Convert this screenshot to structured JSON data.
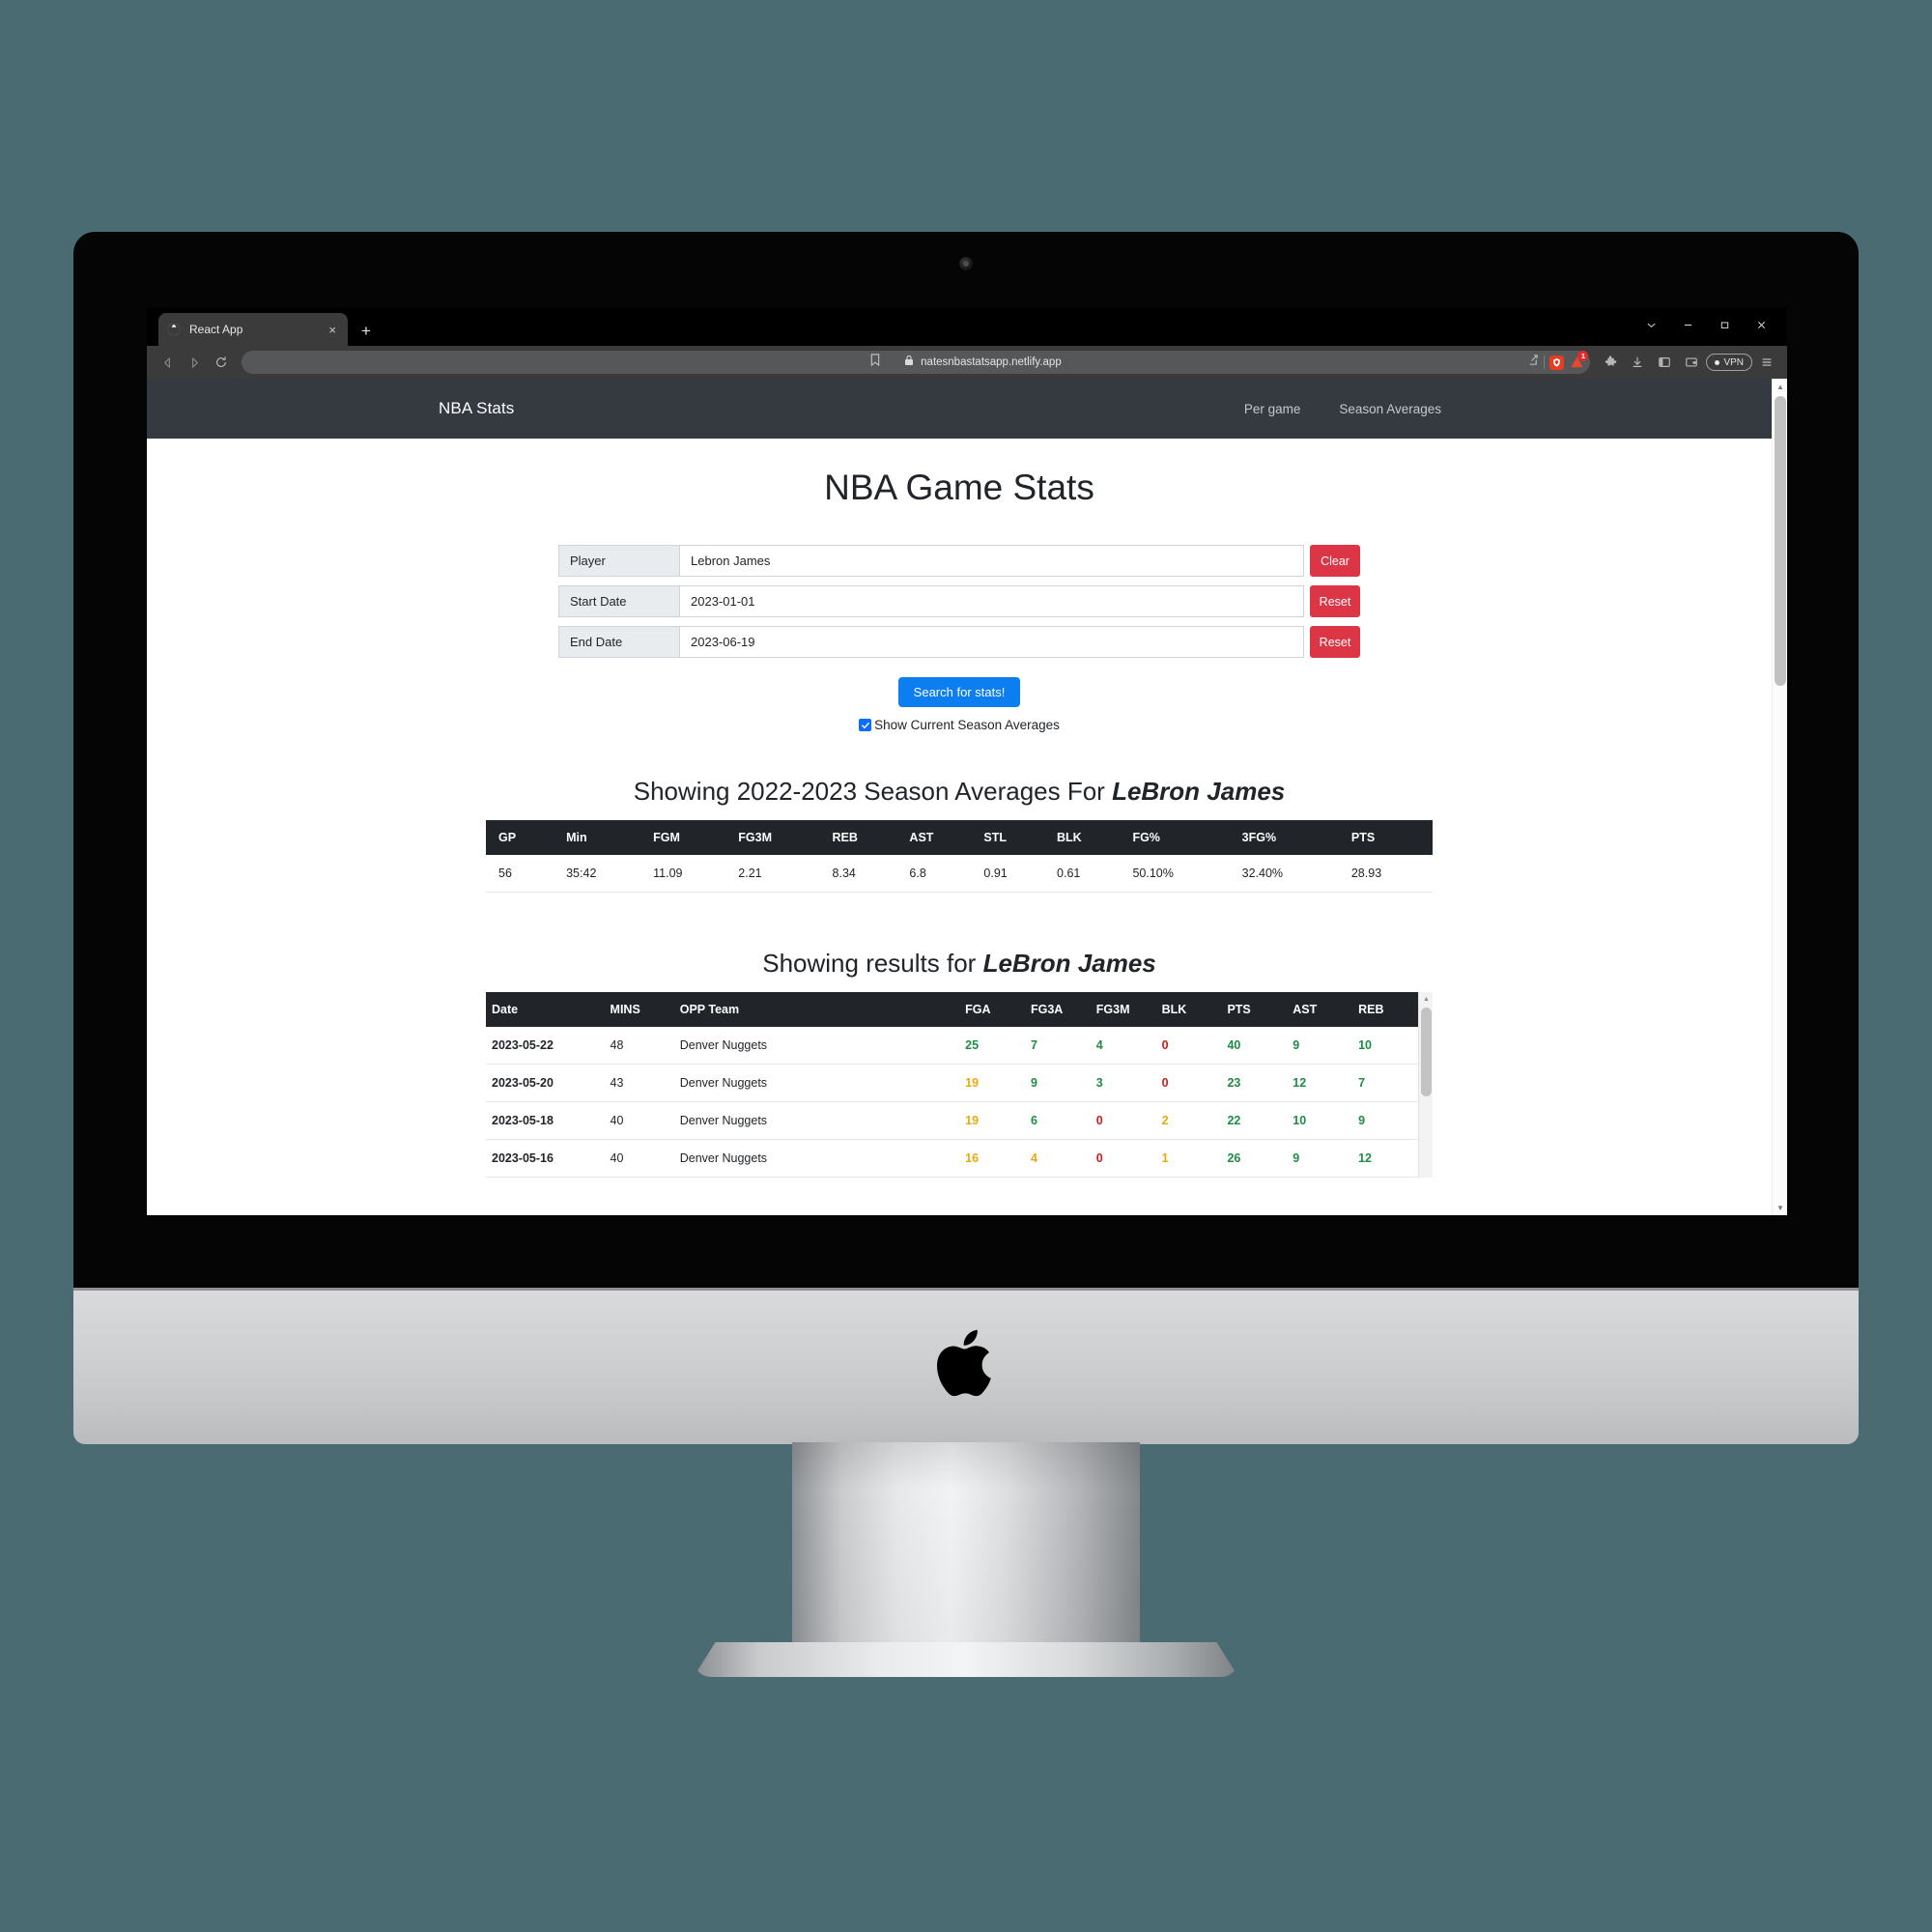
{
  "browser": {
    "tab": {
      "title": "React App",
      "favicon": "globe-icon",
      "close": "×"
    },
    "new_tab": "+",
    "window_controls": {
      "minimize_group": "⌄",
      "minimize": "−",
      "maximize": "❐",
      "close": "✕"
    },
    "nav": {
      "back": "◁",
      "forward": "▷",
      "reload": "⟳",
      "bookmark": "bookmark-icon"
    },
    "omnibox": {
      "lock": "lock-icon",
      "url": "natesnbastatsapp.netlify.app",
      "share": "share-icon"
    },
    "shield_badge_count": "1",
    "toolbar_right": {
      "extensions": "puzzle-icon",
      "downloads": "download-icon",
      "sidebar": "sidebar-icon",
      "wallet": "wallet-icon",
      "vpn_label": "VPN",
      "menu": "☰"
    }
  },
  "site": {
    "navbar": {
      "brand": "NBA Stats",
      "links": [
        {
          "label": "Per game"
        },
        {
          "label": "Season Averages"
        }
      ]
    },
    "page_title": "NBA Game Stats",
    "form": {
      "rows": [
        {
          "label": "Player",
          "value": "Lebron James",
          "button": "Clear"
        },
        {
          "label": "Start Date",
          "value": "2023-01-01",
          "button": "Reset"
        },
        {
          "label": "End Date",
          "value": "2023-06-19",
          "button": "Reset"
        }
      ],
      "search_button": "Search for stats!",
      "checkbox_label": "Show Current Season Averages",
      "checkbox_checked": true
    },
    "season_averages": {
      "heading_prefix": "Showing 2022-2023 Season Averages For ",
      "heading_player": "LeBron James",
      "columns": [
        "GP",
        "Min",
        "FGM",
        "FG3M",
        "REB",
        "AST",
        "STL",
        "BLK",
        "FG%",
        "3FG%",
        "PTS"
      ],
      "row": [
        "56",
        "35:42",
        "11.09",
        "2.21",
        "8.34",
        "6.8",
        "0.91",
        "0.61",
        "50.10%",
        "32.40%",
        "28.93"
      ]
    },
    "results": {
      "heading_prefix": "Showing results for ",
      "heading_player": "LeBron James",
      "columns": [
        "Date",
        "MINS",
        "OPP Team",
        "FGA",
        "FG3A",
        "FG3M",
        "BLK",
        "PTS",
        "AST",
        "REB"
      ],
      "rows": [
        {
          "date": "2023-05-22",
          "mins": "48",
          "team": "Denver Nuggets",
          "fga": {
            "v": "25",
            "c": "green"
          },
          "fg3a": {
            "v": "7",
            "c": "green"
          },
          "fg3m": {
            "v": "4",
            "c": "green"
          },
          "blk": {
            "v": "0",
            "c": "red"
          },
          "pts": {
            "v": "40",
            "c": "green"
          },
          "ast": {
            "v": "9",
            "c": "green"
          },
          "reb": {
            "v": "10",
            "c": "green"
          }
        },
        {
          "date": "2023-05-20",
          "mins": "43",
          "team": "Denver Nuggets",
          "fga": {
            "v": "19",
            "c": "amber"
          },
          "fg3a": {
            "v": "9",
            "c": "green"
          },
          "fg3m": {
            "v": "3",
            "c": "green"
          },
          "blk": {
            "v": "0",
            "c": "red"
          },
          "pts": {
            "v": "23",
            "c": "green"
          },
          "ast": {
            "v": "12",
            "c": "green"
          },
          "reb": {
            "v": "7",
            "c": "green"
          }
        },
        {
          "date": "2023-05-18",
          "mins": "40",
          "team": "Denver Nuggets",
          "fga": {
            "v": "19",
            "c": "amber"
          },
          "fg3a": {
            "v": "6",
            "c": "green"
          },
          "fg3m": {
            "v": "0",
            "c": "red"
          },
          "blk": {
            "v": "2",
            "c": "amber"
          },
          "pts": {
            "v": "22",
            "c": "green"
          },
          "ast": {
            "v": "10",
            "c": "green"
          },
          "reb": {
            "v": "9",
            "c": "green"
          }
        },
        {
          "date": "2023-05-16",
          "mins": "40",
          "team": "Denver Nuggets",
          "fga": {
            "v": "16",
            "c": "amber"
          },
          "fg3a": {
            "v": "4",
            "c": "amber"
          },
          "fg3m": {
            "v": "0",
            "c": "red"
          },
          "blk": {
            "v": "1",
            "c": "amber"
          },
          "pts": {
            "v": "26",
            "c": "green"
          },
          "ast": {
            "v": "9",
            "c": "green"
          },
          "reb": {
            "v": "12",
            "c": "green"
          }
        }
      ]
    }
  },
  "colors": {
    "background": "#4b6b73",
    "navbar": "#343a40",
    "table_header": "#212529",
    "danger": "#dc3545",
    "primary": "#0d7ef0",
    "value_green": "#1e8c45",
    "value_red": "#d01b1b",
    "value_amber": "#e8a911"
  }
}
